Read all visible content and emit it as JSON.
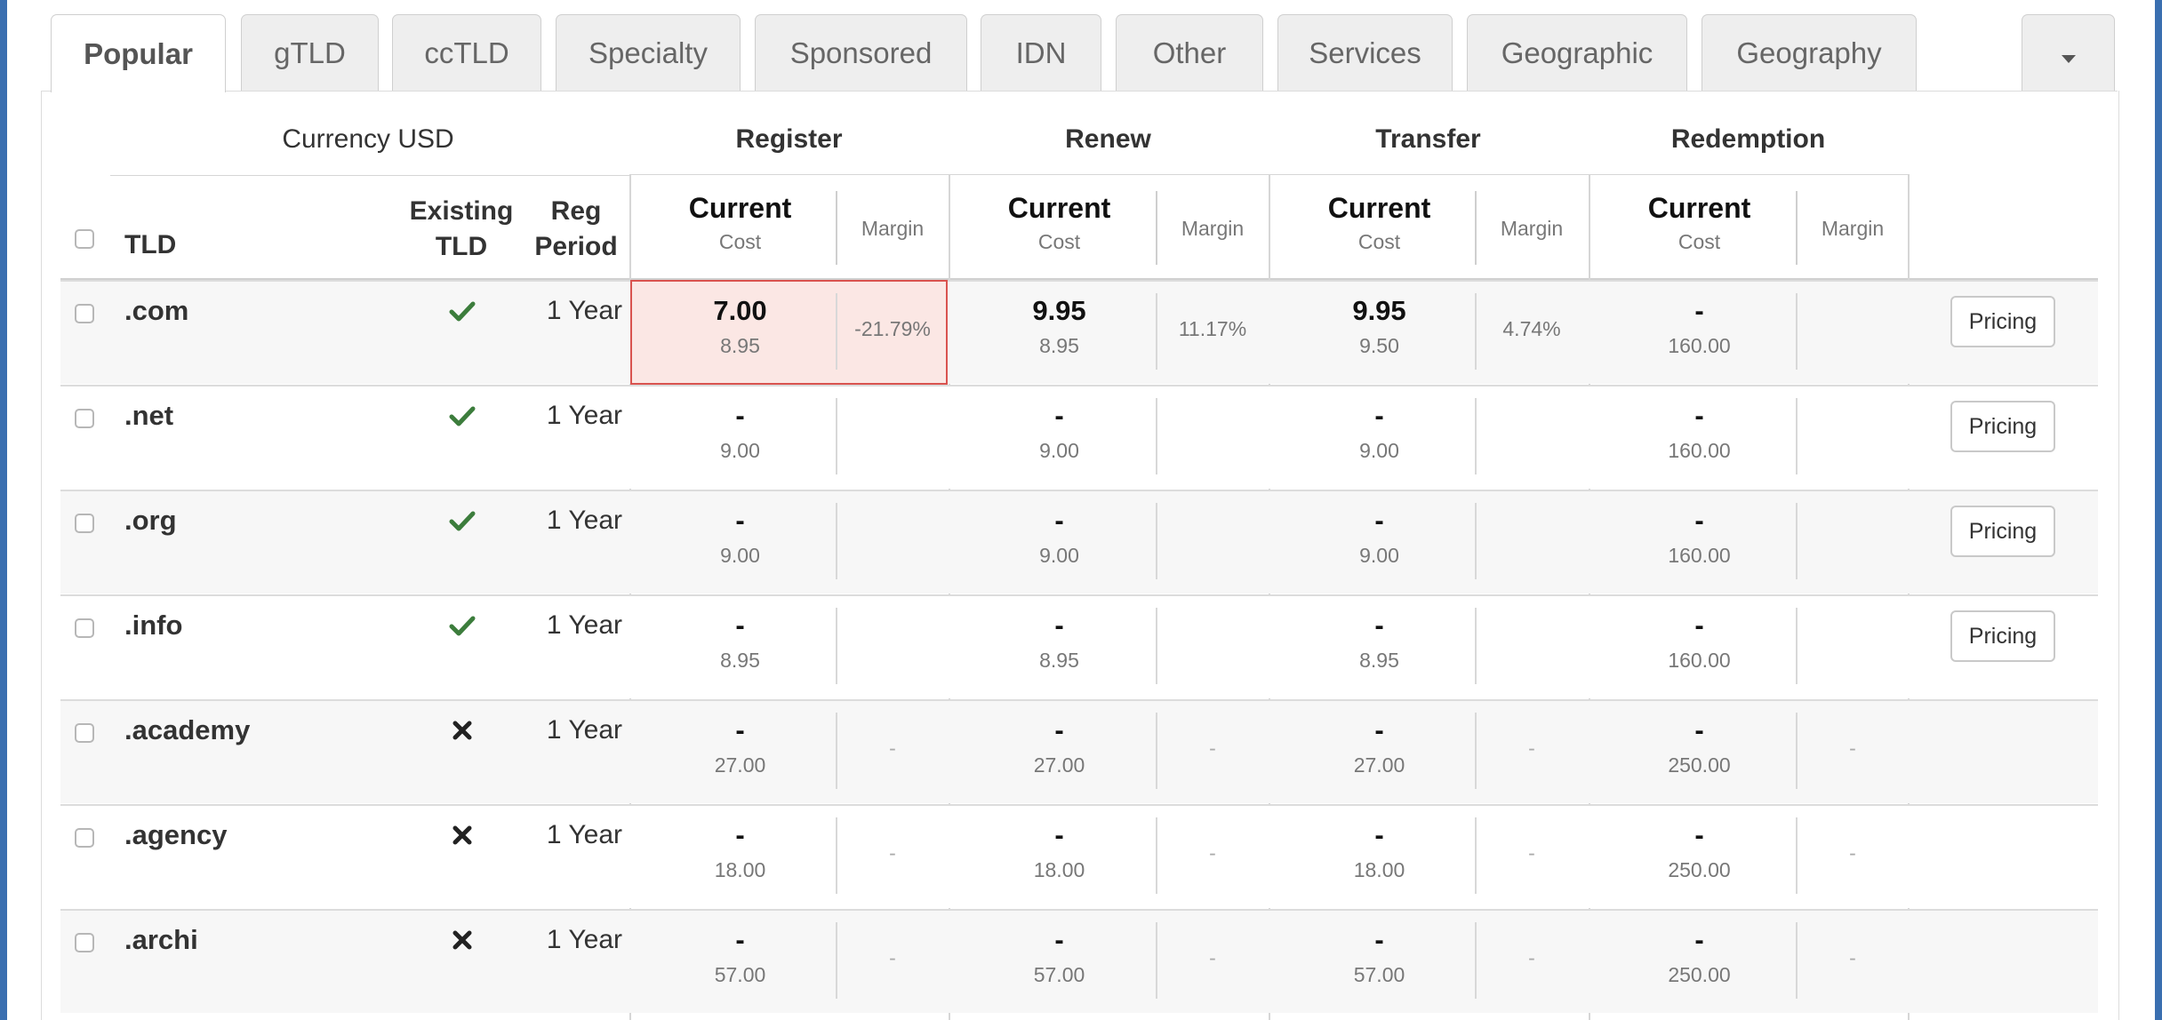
{
  "tabs": [
    {
      "label": "Popular",
      "active": true
    },
    {
      "label": "gTLD"
    },
    {
      "label": "ccTLD"
    },
    {
      "label": "Specialty"
    },
    {
      "label": "Sponsored"
    },
    {
      "label": "IDN"
    },
    {
      "label": "Other"
    },
    {
      "label": "Services"
    },
    {
      "label": "Geographic"
    },
    {
      "label": "Geography"
    }
  ],
  "header": {
    "currency": "Currency USD",
    "groups": {
      "register": "Register",
      "renew": "Renew",
      "transfer": "Transfer",
      "redemption": "Redemption"
    },
    "tld": "TLD",
    "existing": "Existing TLD",
    "existing_l1": "Existing",
    "existing_l2": "TLD",
    "reg_l1": "Reg",
    "reg_l2": "Period",
    "current": "Current",
    "cost": "Cost",
    "margin": "Margin"
  },
  "colors": {
    "check": "#3c7d3c",
    "highlight_bg": "#fbe7e4",
    "highlight_border": "#d9534f"
  },
  "rows": [
    {
      "tld": ".com",
      "existing": "check-icon",
      "period": "1 Year",
      "register": {
        "current": "7.00",
        "cost": "8.95",
        "margin": "-21.79%"
      },
      "renew": {
        "current": "9.95",
        "cost": "8.95",
        "margin": "11.17%"
      },
      "transfer": {
        "current": "9.95",
        "cost": "9.50",
        "margin": "4.74%"
      },
      "redemption": {
        "current": "-",
        "cost": "160.00",
        "margin": ""
      },
      "pricing": "Pricing"
    },
    {
      "tld": ".net",
      "existing": "check-icon",
      "period": "1 Year",
      "register": {
        "current": "-",
        "cost": "9.00",
        "margin": ""
      },
      "renew": {
        "current": "-",
        "cost": "9.00",
        "margin": ""
      },
      "transfer": {
        "current": "-",
        "cost": "9.00",
        "margin": ""
      },
      "redemption": {
        "current": "-",
        "cost": "160.00",
        "margin": ""
      },
      "pricing": "Pricing"
    },
    {
      "tld": ".org",
      "existing": "check-icon",
      "period": "1 Year",
      "register": {
        "current": "-",
        "cost": "9.00",
        "margin": ""
      },
      "renew": {
        "current": "-",
        "cost": "9.00",
        "margin": ""
      },
      "transfer": {
        "current": "-",
        "cost": "9.00",
        "margin": ""
      },
      "redemption": {
        "current": "-",
        "cost": "160.00",
        "margin": ""
      },
      "pricing": "Pricing"
    },
    {
      "tld": ".info",
      "existing": "check-icon",
      "period": "1 Year",
      "register": {
        "current": "-",
        "cost": "8.95",
        "margin": ""
      },
      "renew": {
        "current": "-",
        "cost": "8.95",
        "margin": ""
      },
      "transfer": {
        "current": "-",
        "cost": "8.95",
        "margin": ""
      },
      "redemption": {
        "current": "-",
        "cost": "160.00",
        "margin": ""
      },
      "pricing": "Pricing"
    },
    {
      "tld": ".academy",
      "existing": "cross-icon",
      "period": "1 Year",
      "register": {
        "current": "-",
        "cost": "27.00",
        "margin": "-"
      },
      "renew": {
        "current": "-",
        "cost": "27.00",
        "margin": "-"
      },
      "transfer": {
        "current": "-",
        "cost": "27.00",
        "margin": "-"
      },
      "redemption": {
        "current": "-",
        "cost": "250.00",
        "margin": "-"
      },
      "pricing": ""
    },
    {
      "tld": ".agency",
      "existing": "cross-icon",
      "period": "1 Year",
      "register": {
        "current": "-",
        "cost": "18.00",
        "margin": "-"
      },
      "renew": {
        "current": "-",
        "cost": "18.00",
        "margin": "-"
      },
      "transfer": {
        "current": "-",
        "cost": "18.00",
        "margin": "-"
      },
      "redemption": {
        "current": "-",
        "cost": "250.00",
        "margin": "-"
      },
      "pricing": ""
    },
    {
      "tld": ".archi",
      "existing": "cross-icon",
      "period": "1 Year",
      "register": {
        "current": "-",
        "cost": "57.00",
        "margin": "-"
      },
      "renew": {
        "current": "-",
        "cost": "57.00",
        "margin": "-"
      },
      "transfer": {
        "current": "-",
        "cost": "57.00",
        "margin": "-"
      },
      "redemption": {
        "current": "-",
        "cost": "250.00",
        "margin": "-"
      },
      "pricing": ""
    }
  ]
}
